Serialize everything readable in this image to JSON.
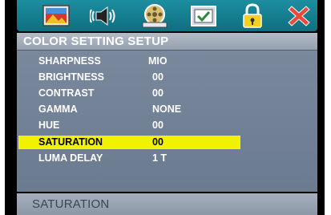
{
  "tabs": [
    {
      "name": "picture-tab-icon"
    },
    {
      "name": "audio-tab-icon"
    },
    {
      "name": "video-reel-tab-icon"
    },
    {
      "name": "checkbox-preference-tab-icon"
    },
    {
      "name": "lock-tab-icon"
    },
    {
      "name": "exit-tab-icon"
    }
  ],
  "menu": {
    "title": "COLOR SETTING SETUP",
    "rows": [
      {
        "label": "SHARPNESS",
        "value": "MIO"
      },
      {
        "label": "BRIGHTNESS",
        "value": "00"
      },
      {
        "label": "CONTRAST",
        "value": "00"
      },
      {
        "label": "GAMMA",
        "value": "NONE"
      },
      {
        "label": "HUE",
        "value": "00"
      },
      {
        "label": "SATURATION",
        "value": "00",
        "selected": true
      },
      {
        "label": "LUMA DELAY",
        "value": "1 T"
      }
    ]
  },
  "status": {
    "text": "SATURATION"
  },
  "colors": {
    "highlight": "#f1f200",
    "panel": "#6b7b90",
    "tabbar": "#1c8ea0",
    "exit": "#e84a3c"
  }
}
